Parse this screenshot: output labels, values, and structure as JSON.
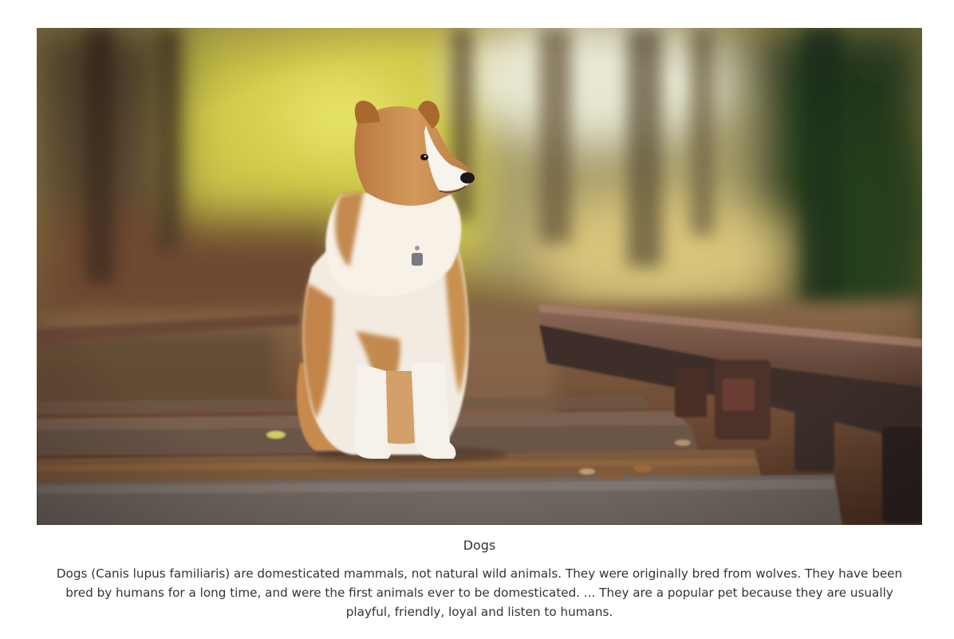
{
  "gallery_item": {
    "image_subject": "dog-photo",
    "title": "Dogs",
    "description": "Dogs (Canis lupus familiaris) are domesticated mammals, not natural wild animals. They were originally bred from wolves. They have been bred by humans for a long time, and were the first animals ever to be domesticated. ... They are a popular pet because they are usually playful, friendly, loyal and listen to humans."
  },
  "colors": {
    "background": "#ffffff",
    "text": "#333333"
  }
}
